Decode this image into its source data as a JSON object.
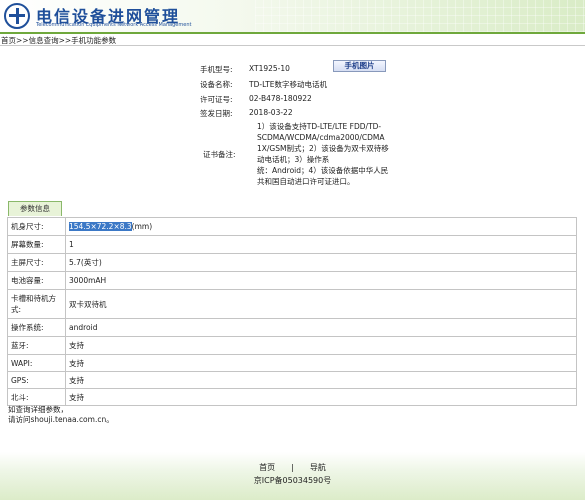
{
  "header": {
    "title": "电信设备进网管理",
    "subtitle": "Telecommunication Equipments Network Access Management"
  },
  "breadcrumb": "首页>>信息查询>>手机功能参数",
  "phone_info": {
    "model_label": "手机型号:",
    "model_value": "XT1925-10",
    "device_label": "设备名称:",
    "device_value": "TD-LTE数字移动电话机",
    "license_label": "许可证号:",
    "license_value": "02-B478-180922",
    "date_label": "签发日期:",
    "date_value": "2018-03-22",
    "cert_label": "证书备注:",
    "cert_lines": [
      "1）该设备支持TD-LTE/LTE FDD/TD-",
      "SCDMA/WCDMA/cdma2000/CDMA",
      "1X/GSM制式；2）该设备为双卡双待移",
      "动电话机；3）操作系",
      "统：Android；4）该设备依据中华人民",
      "共和国自动进口许可证进口。"
    ],
    "photo_button": "手机图片"
  },
  "params_tab": "参数信息",
  "params": [
    {
      "label": "机身尺寸:",
      "value_selected": "154.5×72.2×8.3",
      "value_rest": "(mm)"
    },
    {
      "label": "屏幕数量:",
      "value": "1"
    },
    {
      "label": "主屏尺寸:",
      "value": "5.7(英寸)"
    },
    {
      "label": "电池容量:",
      "value": "3000mAH"
    },
    {
      "label_line1": "卡槽和待机方",
      "label_line2": "式:",
      "value": "双卡双待机"
    },
    {
      "label": "操作系统:",
      "value": "android"
    },
    {
      "label": "蓝牙:",
      "value": "支持"
    },
    {
      "label": "WAPI:",
      "value": "支持"
    },
    {
      "label": "GPS:",
      "value": "支持"
    },
    {
      "label": "北斗:",
      "value": "支持"
    }
  ],
  "footnote": {
    "line1": "如查询详细参数，",
    "line2": "请访问shouji.tenaa.com.cn。"
  },
  "footer": {
    "home": "首页",
    "separator": "|",
    "nav": "导航",
    "icp": "京ICP备05034590号"
  }
}
